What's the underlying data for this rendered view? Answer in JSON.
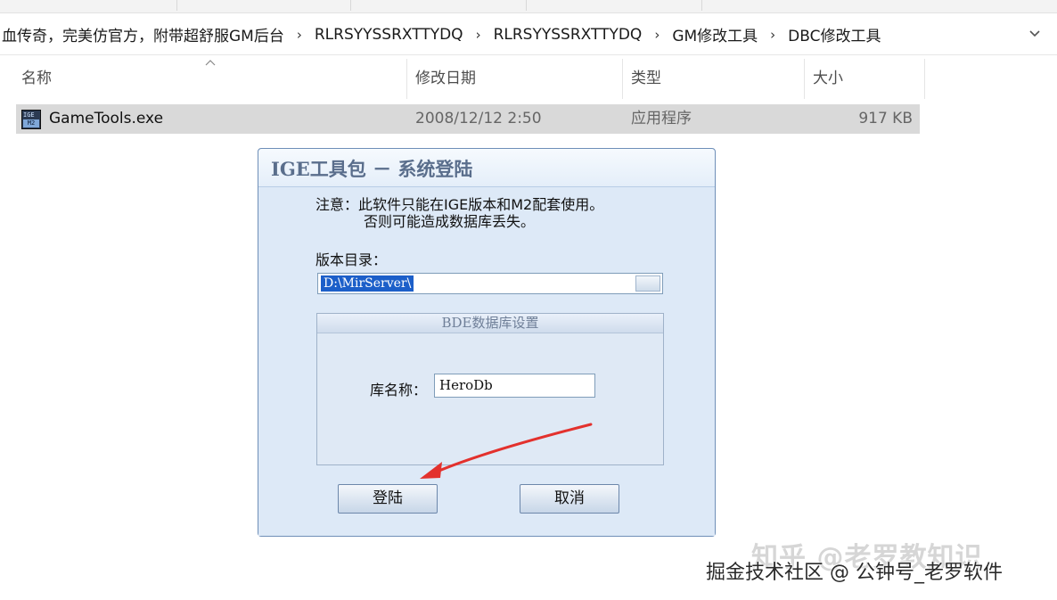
{
  "address_bar": {
    "breadcrumbs": [
      "血传奇，完美仿官方，附带超舒服GM后台",
      "RLRSYYSSRXTTYDQ",
      "RLRSYYSSRXTTYDQ",
      "GM修改工具",
      "DBC修改工具"
    ],
    "separator": "›"
  },
  "columns": {
    "name": "名称",
    "modified": "修改日期",
    "type": "类型",
    "size": "大小"
  },
  "file": {
    "name": "GameTools.exe",
    "modified": "2008/12/12 2:50",
    "type": "应用程序",
    "size": "917 KB"
  },
  "dialog": {
    "title": "IGE工具包 － 系统登陆",
    "notice_line1": "注意：此软件只能在IGE版本和M2配套使用。",
    "notice_line2": "否则可能造成数据库丢失。",
    "version_label": "版本目录：",
    "version_value": "D:\\MirServer\\",
    "group_title": "BDE数据库设置",
    "db_label": "库名称：",
    "db_value": "HeroDb",
    "login_button": "登陆",
    "cancel_button": "取消"
  },
  "watermark": {
    "top": "知乎 @老罗教知识",
    "bottom": "掘金技术社区 @ 公钟号_老罗软件"
  },
  "colors": {
    "dialog_bg": "#dde9f7",
    "selection": "#1c5fc9",
    "arrow": "#e3312d",
    "row_selected": "#d9d9d9"
  }
}
